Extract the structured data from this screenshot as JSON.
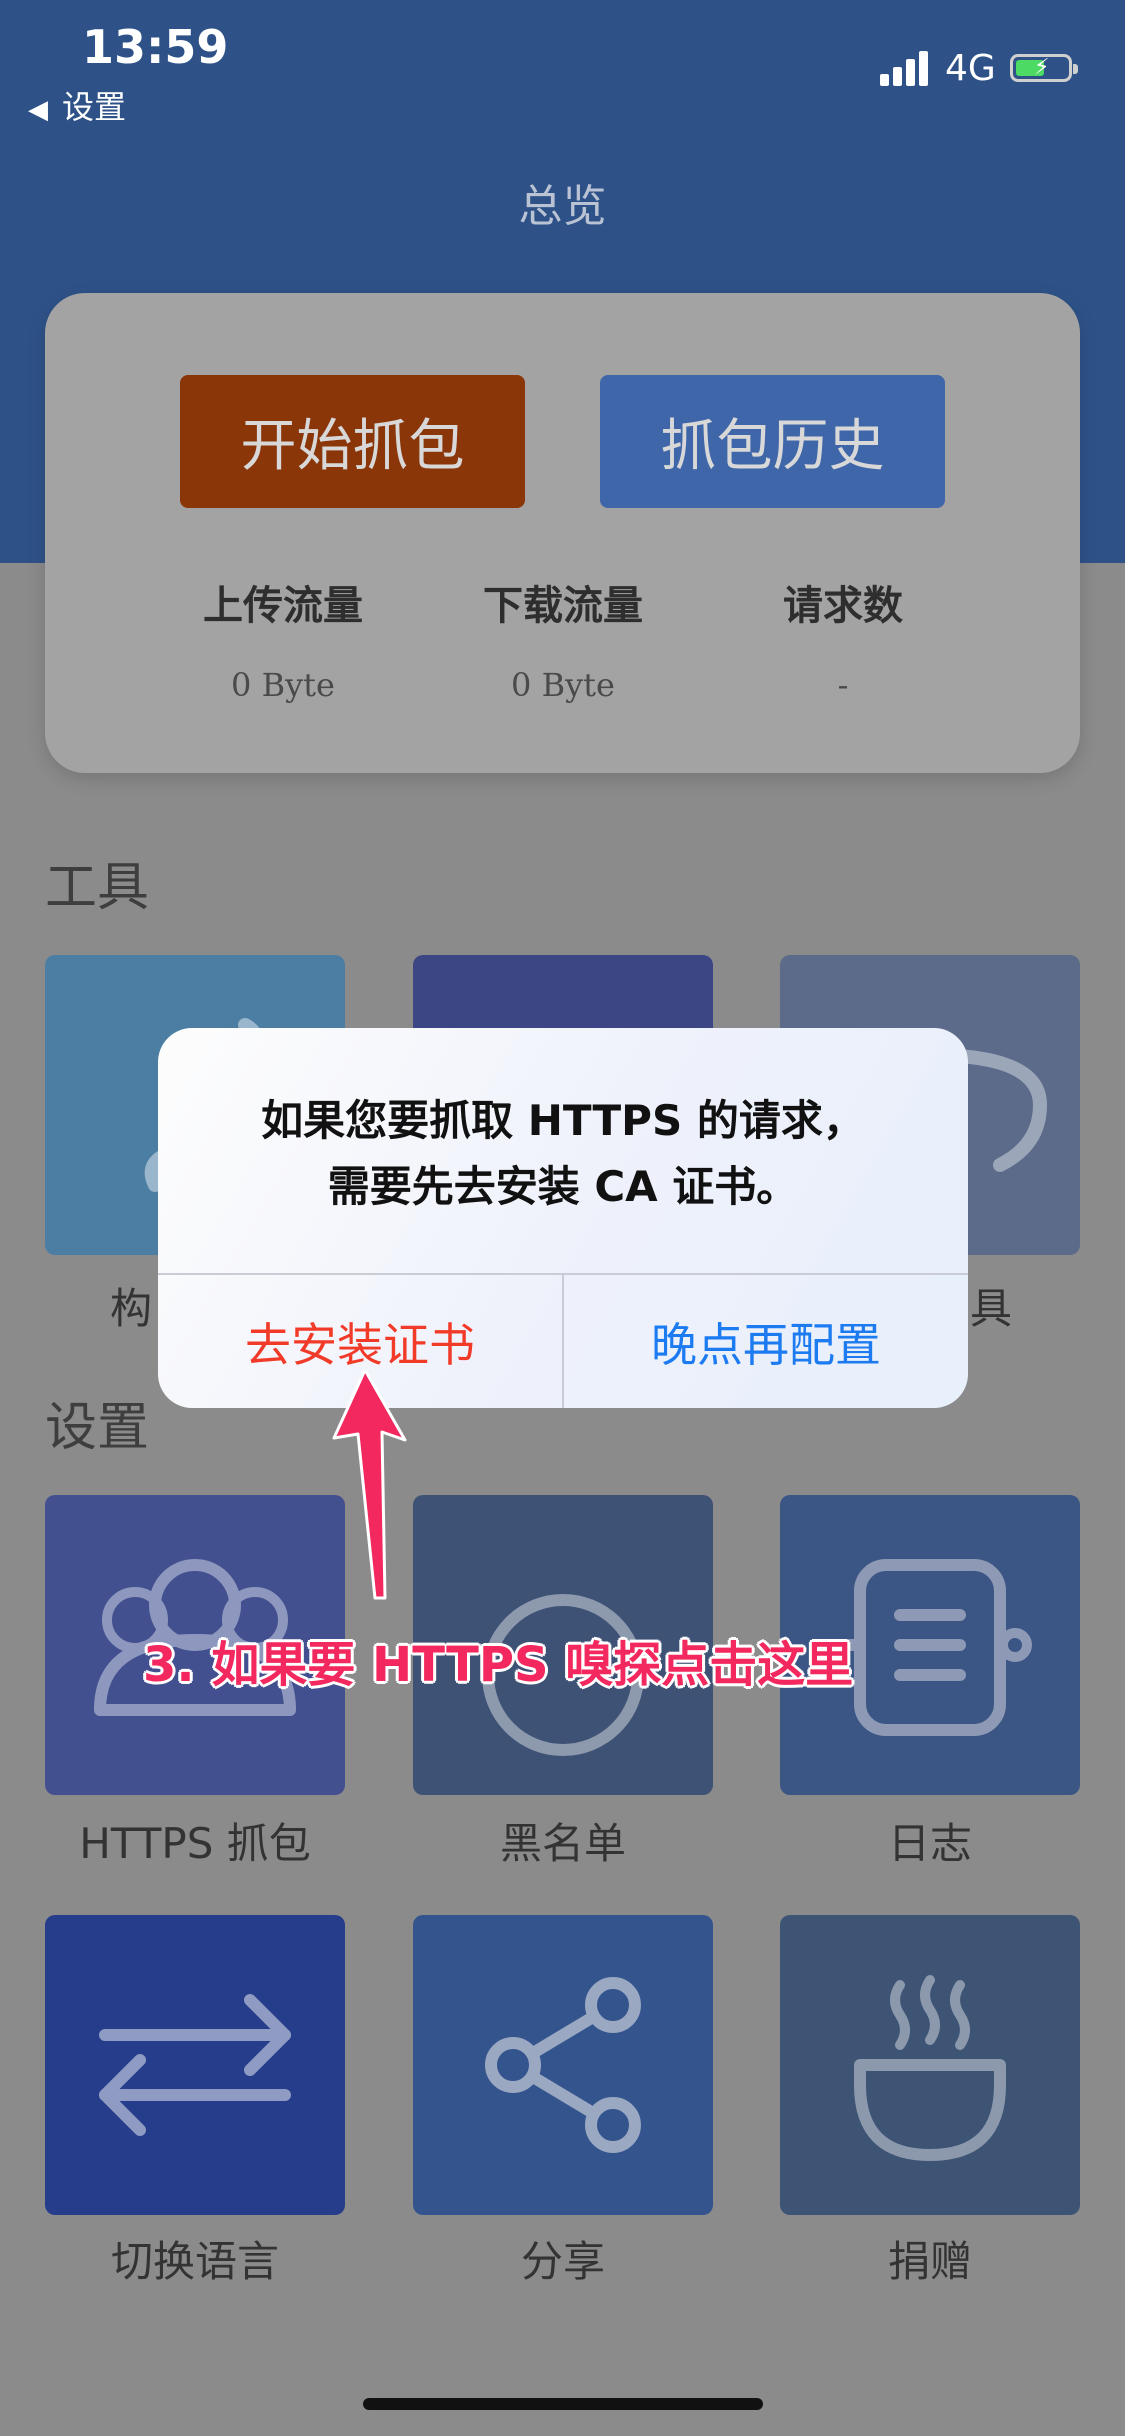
{
  "status_bar": {
    "time": "13:59",
    "back_label": "设置",
    "network": "4G"
  },
  "header": {
    "title": "总览"
  },
  "overview": {
    "start_capture": "开始抓包",
    "history": "抓包历史",
    "stats": [
      {
        "label": "上传流量",
        "value": "0 Byte"
      },
      {
        "label": "下载流量",
        "value": "0 Byte"
      },
      {
        "label": "请求数",
        "value": "-"
      }
    ]
  },
  "sections": {
    "tools": "工具",
    "settings": "设置"
  },
  "tools": [
    {
      "label": "构",
      "icon": "build-icon"
    },
    {
      "label": "",
      "icon": "tool-icon"
    },
    {
      "label": "具",
      "icon": "mug-icon"
    }
  ],
  "settings_items": [
    {
      "label": "HTTPS 抓包",
      "icon": "users-icon"
    },
    {
      "label": "黑名单",
      "icon": "circle-icon"
    },
    {
      "label": "日志",
      "icon": "notebook-icon"
    },
    {
      "label": "切换语言",
      "icon": "swap-icon"
    },
    {
      "label": "分享",
      "icon": "share-icon"
    },
    {
      "label": "捐赠",
      "icon": "coffee-icon"
    }
  ],
  "dialog": {
    "line1": "如果您要抓取 HTTPS 的请求，",
    "line2": "需要先去安装 CA 证书。",
    "install_button": "去安装证书",
    "later_button": "晚点再配置"
  },
  "annotation": {
    "text": "3. 如果要 HTTPS 嗅探点击这里"
  },
  "colors": {
    "header": "#2e5288",
    "start_button": "#8a3609",
    "history_button": "#3e66a8",
    "install_text": "#f23a28",
    "later_text": "#1d7bf1",
    "annotation": "#f2285e"
  }
}
